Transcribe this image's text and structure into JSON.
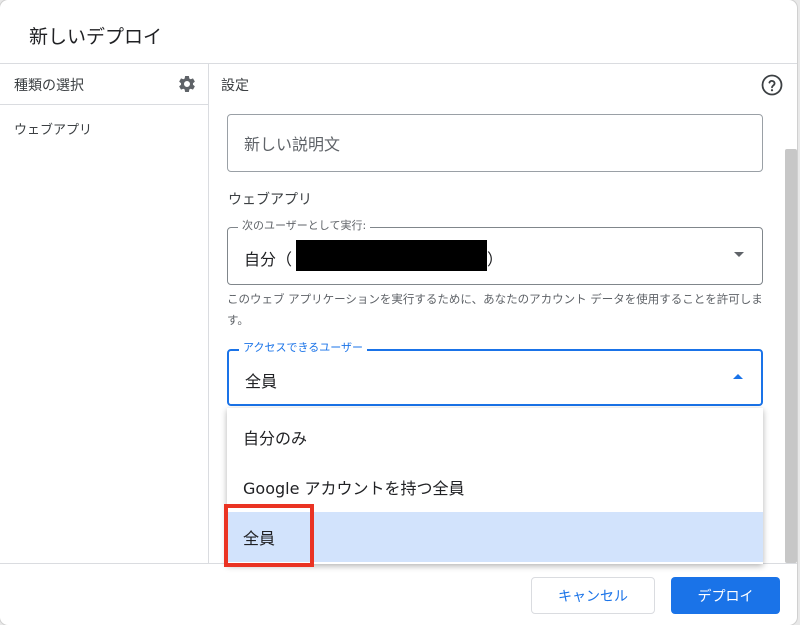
{
  "dialog": {
    "title": "新しいデプロイ"
  },
  "left_panel": {
    "header": "種類の選択",
    "settings_icon": "gear-icon",
    "items": [
      {
        "label": "ウェブアプリ"
      }
    ]
  },
  "right_panel": {
    "header": "設定",
    "help_icon": "help-circle-icon",
    "description_placeholder": "新しい説明文",
    "section_title": "ウェブアプリ",
    "run_as": {
      "label": "次のユーザーとして実行:",
      "value_prefix": "自分（",
      "value_suffix": "）"
    },
    "help_text": "このウェブ アプリケーションを実行するために、あなたのアカウント データを使用することを許可します。",
    "access": {
      "label": "アクセスできるユーザー",
      "value": "全員",
      "options": [
        "自分のみ",
        "Google アカウントを持つ全員",
        "全員"
      ],
      "selected_index": 2
    }
  },
  "footer": {
    "cancel_label": "キャンセル",
    "deploy_label": "デプロイ"
  },
  "colors": {
    "accent": "#1a73e8",
    "selected_bg": "#d2e3fc",
    "annotation_red": "#ea3323"
  }
}
